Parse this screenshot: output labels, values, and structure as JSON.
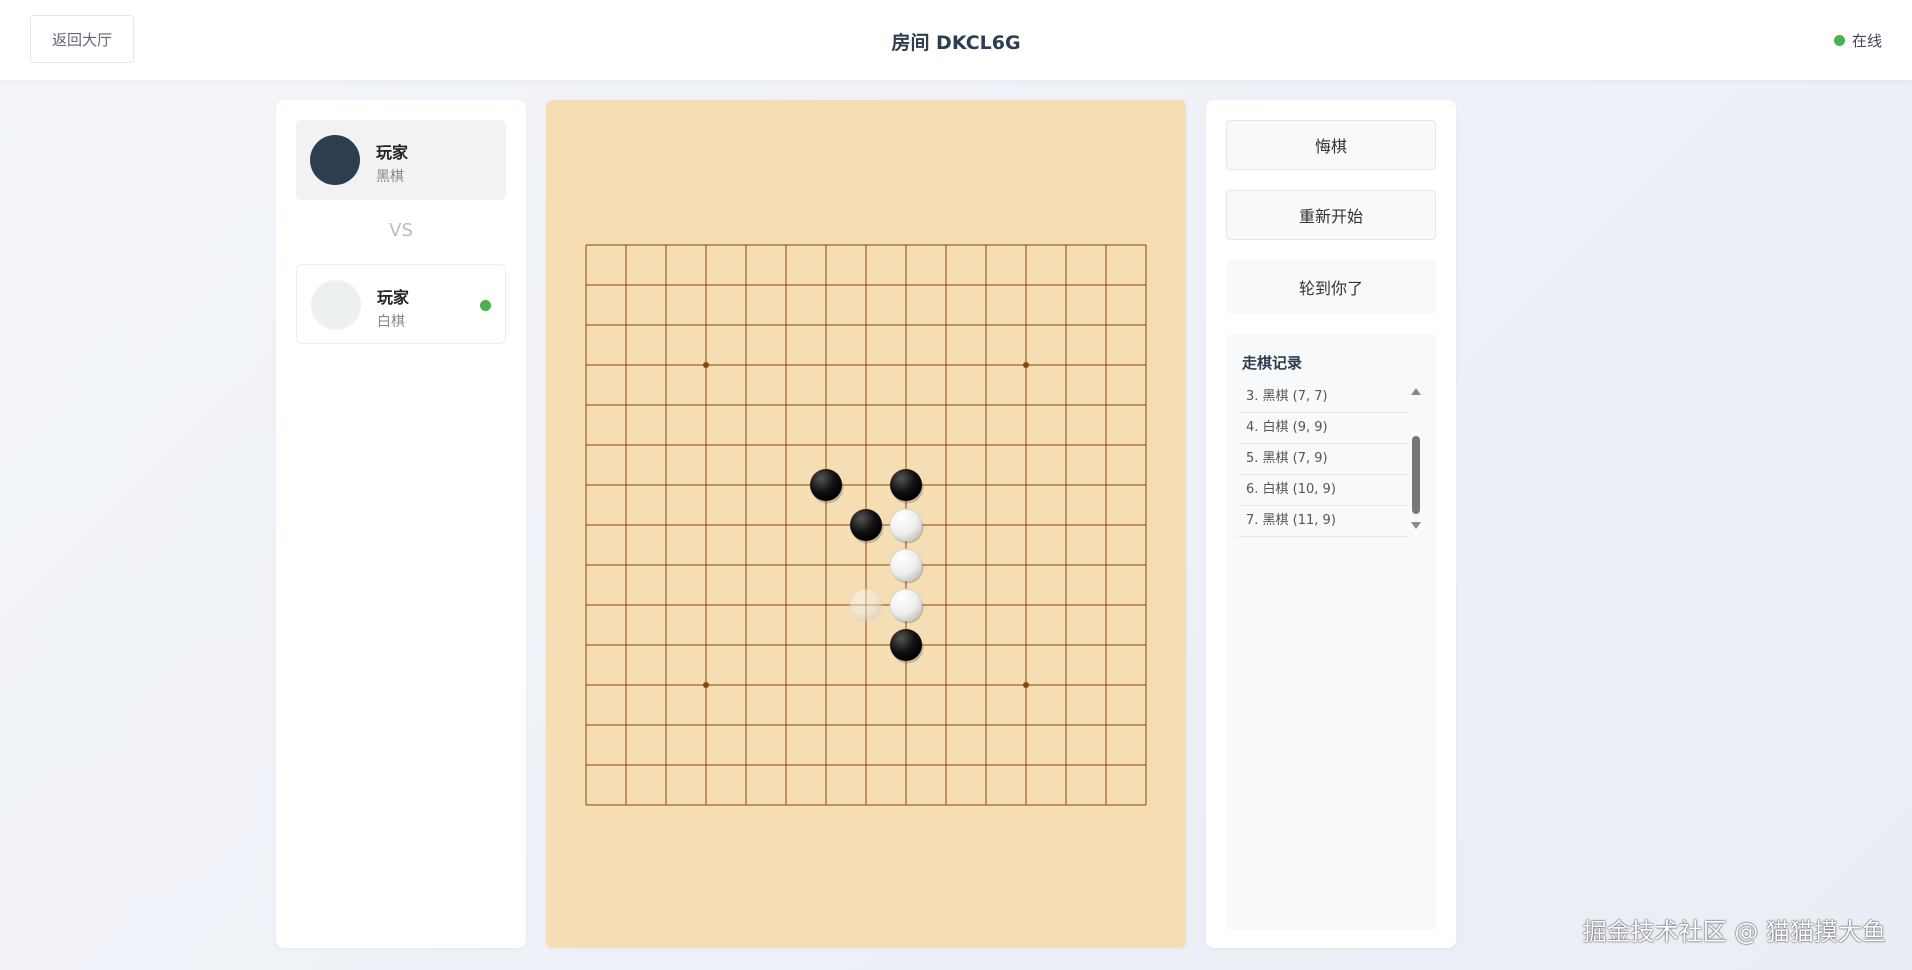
{
  "header": {
    "back_label": "返回大厅",
    "room_title": "房间 DKCL6G",
    "online_label": "在线",
    "online_color": "#4caf50"
  },
  "players": {
    "black": {
      "name": "玩家",
      "color_label": "黑棋"
    },
    "vs_label": "VS",
    "white": {
      "name": "玩家",
      "color_label": "白棋"
    }
  },
  "actions": {
    "undo_label": "悔棋",
    "restart_label": "重新开始",
    "turn_label": "轮到你了"
  },
  "history": {
    "title": "走棋记录",
    "items": [
      "3. 黑棋 (7, 7)",
      "4. 白棋 (9, 9)",
      "5. 黑棋 (7, 9)",
      "6. 白棋 (10, 9)",
      "7. 黑棋 (11, 9)"
    ]
  },
  "board": {
    "size": 15,
    "background": "#f5deb3",
    "line_color": "#8b4513",
    "star_points": [
      [
        3,
        3
      ],
      [
        3,
        11
      ],
      [
        11,
        3
      ],
      [
        11,
        11
      ]
    ],
    "stones": [
      {
        "row": 6,
        "col": 6,
        "color": "black"
      },
      {
        "row": 6,
        "col": 8,
        "color": "black"
      },
      {
        "row": 7,
        "col": 7,
        "color": "black"
      },
      {
        "row": 7,
        "col": 8,
        "color": "white"
      },
      {
        "row": 8,
        "col": 8,
        "color": "white"
      },
      {
        "row": 9,
        "col": 8,
        "color": "white"
      },
      {
        "row": 10,
        "col": 8,
        "color": "black"
      }
    ],
    "hover_stone": {
      "row": 9,
      "col": 7,
      "color": "white"
    }
  },
  "watermark": "掘金技术社区 @ 猫猫摸大鱼"
}
